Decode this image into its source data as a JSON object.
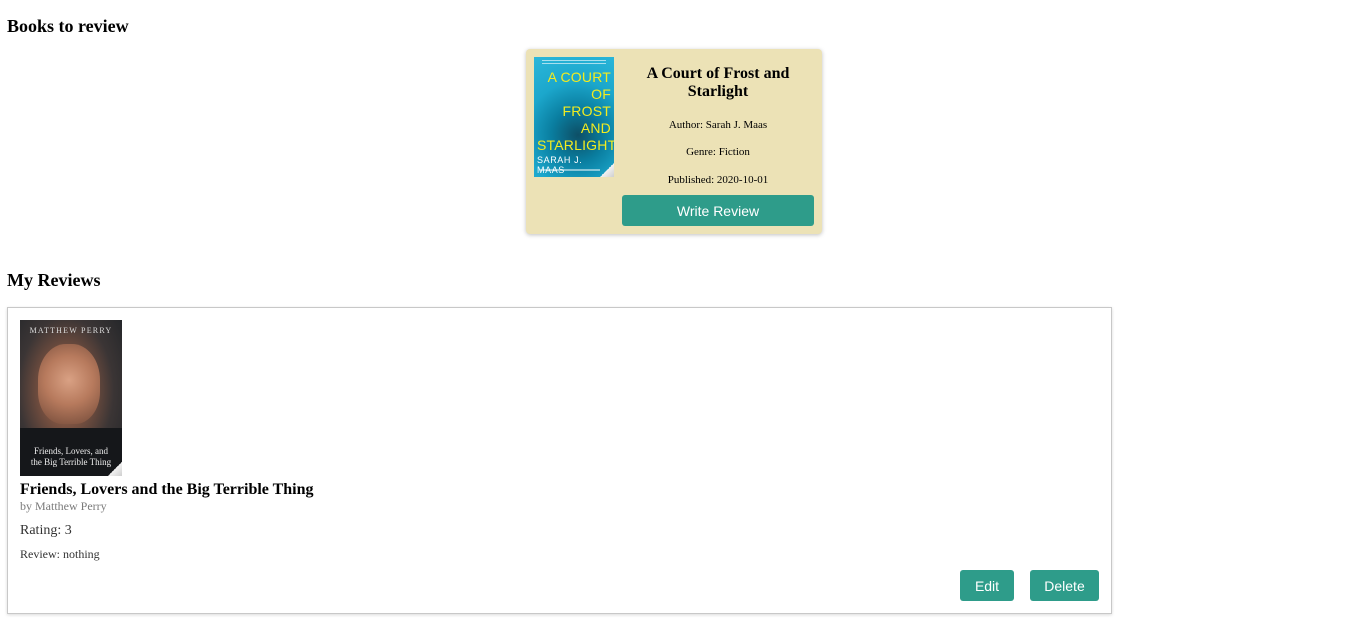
{
  "sections": {
    "books_heading": "Books to review",
    "reviews_heading": "My Reviews"
  },
  "book_to_review": {
    "cover": {
      "title": "A COURT\nOF\nFROST\nAND\nSTARLIGHT",
      "author": "SARAH J. MAAS"
    },
    "title": "A Court of Frost and Starlight",
    "author": "Author: Sarah J. Maas",
    "genre": "Genre: Fiction",
    "published": "Published: 2020-10-01",
    "write_review_label": "Write Review"
  },
  "my_reviews": [
    {
      "cover": {
        "author": "MATTHEW PERRY",
        "title": "Friends, Lovers, and\nthe Big Terrible Thing"
      },
      "title": "Friends, Lovers and the Big Terrible Thing",
      "by": "by Matthew Perry",
      "rating": "Rating: 3",
      "review": "Review: nothing",
      "edit_label": "Edit",
      "delete_label": "Delete"
    }
  ],
  "colors": {
    "card_background": "#ece2b6",
    "button": "#2e9c8a"
  }
}
